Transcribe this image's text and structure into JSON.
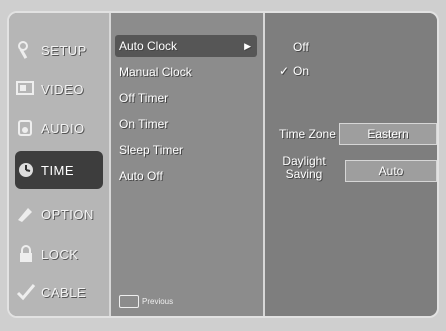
{
  "nav": {
    "items": [
      {
        "label": "SETUP",
        "icon": "setup-icon"
      },
      {
        "label": "VIDEO",
        "icon": "video-icon"
      },
      {
        "label": "AUDIO",
        "icon": "audio-icon"
      },
      {
        "label": "TIME",
        "icon": "time-icon"
      },
      {
        "label": "OPTION",
        "icon": "option-icon"
      },
      {
        "label": "LOCK",
        "icon": "lock-icon"
      },
      {
        "label": "CABLE",
        "icon": "cable-icon"
      }
    ],
    "selected": "TIME"
  },
  "submenu": {
    "items": [
      {
        "label": "Auto Clock",
        "arrow": "▶"
      },
      {
        "label": "Manual Clock"
      },
      {
        "label": "Off Timer"
      },
      {
        "label": "On Timer"
      },
      {
        "label": "Sleep Timer"
      },
      {
        "label": "Auto Off"
      }
    ],
    "selected": "Auto Clock"
  },
  "options": {
    "off_label": "Off",
    "on_label": "On",
    "check_mark": "✓"
  },
  "settings": {
    "time_zone_label": "Time Zone",
    "time_zone_value": "Eastern",
    "daylight_label_line1": "Daylight",
    "daylight_label_line2": "Saving",
    "daylight_value": "Auto"
  },
  "footer": {
    "hint_text": "Previous"
  }
}
